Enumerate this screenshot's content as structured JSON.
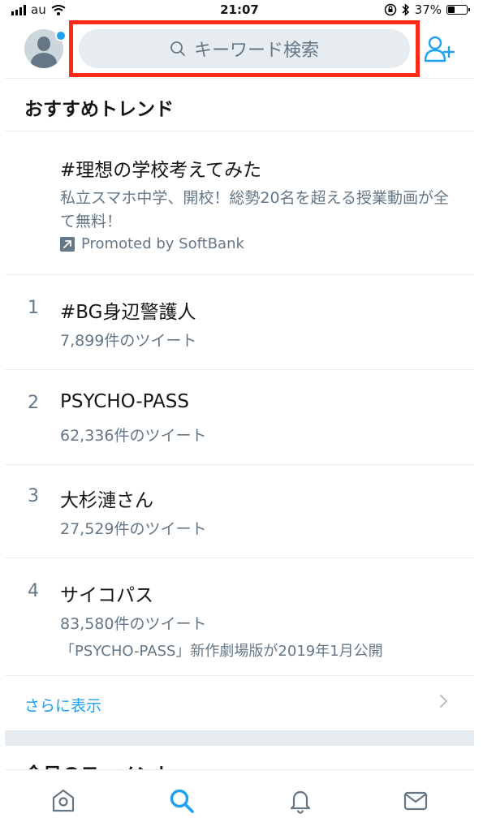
{
  "status_bar": {
    "carrier": "au",
    "time": "21:07",
    "battery": "37%",
    "battery_level": 0.37
  },
  "header": {
    "search_placeholder": "キーワード検索",
    "icons": {
      "avatar": "profile-avatar",
      "search": "search-icon",
      "add_user": "add-user-icon"
    }
  },
  "trends": {
    "section_title": "おすすめトレンド",
    "promoted": {
      "name": "#理想の学校考えてみた",
      "description": "私立スマホ中学、開校！総勢20名を超える授業動画が全て無料！",
      "promoted_by": "Promoted by SoftBank"
    },
    "items": [
      {
        "rank": "1",
        "name": "#BG身辺警護人",
        "count": "7,899件のツイート"
      },
      {
        "rank": "2",
        "name": "PSYCHO-PASS",
        "count": "62,336件のツイート"
      },
      {
        "rank": "3",
        "name": "大杉漣さん",
        "count": "27,529件のツイート"
      },
      {
        "rank": "4",
        "name": "サイコパス",
        "count": "83,580件のツイート",
        "description": "「PSYCHO-PASS」新作劇場版が2019年1月公開"
      }
    ],
    "show_more": "さらに表示"
  },
  "next_section_title": "今日のモーメント",
  "colors": {
    "accent": "#1da1f2",
    "secondary_text": "#657786",
    "highlight": "#ff2a16"
  }
}
